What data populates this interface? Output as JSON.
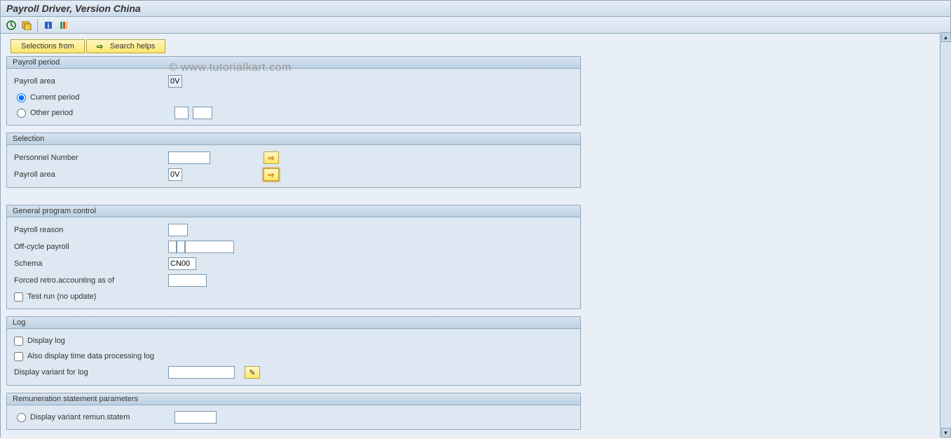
{
  "title": "Payroll Driver, Version China",
  "watermark": "© www.tutorialkart.com",
  "buttons": {
    "selections_from": "Selections from",
    "search_helps": "Search helps"
  },
  "groups": {
    "payroll_period": {
      "title": "Payroll period",
      "payroll_area_label": "Payroll area",
      "payroll_area_value": "0V",
      "current_period": "Current period",
      "other_period": "Other period",
      "other_period_v1": "",
      "other_period_v2": ""
    },
    "selection": {
      "title": "Selection",
      "personnel_number_label": "Personnel Number",
      "personnel_number_value": "",
      "payroll_area_label": "Payroll area",
      "payroll_area_value": "0V"
    },
    "general": {
      "title": "General program control",
      "payroll_reason_label": "Payroll reason",
      "payroll_reason_value": "",
      "off_cycle_label": "Off-cycle payroll",
      "off_cycle_v1": "",
      "off_cycle_v2": "",
      "off_cycle_v3": "",
      "schema_label": "Schema",
      "schema_value": "CN00",
      "forced_retro_label": "Forced retro.accounting as of",
      "forced_retro_value": "",
      "test_run": "Test run (no update)"
    },
    "log_grp": {
      "title": "Log",
      "display_log": "Display log",
      "also_display_time": "Also display time data processing log",
      "display_variant_label": "Display variant for log",
      "display_variant_value": ""
    },
    "remun": {
      "title": "Remuneration statement parameters",
      "display_variant_remun": "Display variant remun.statem",
      "display_variant_remun_value": ""
    }
  }
}
